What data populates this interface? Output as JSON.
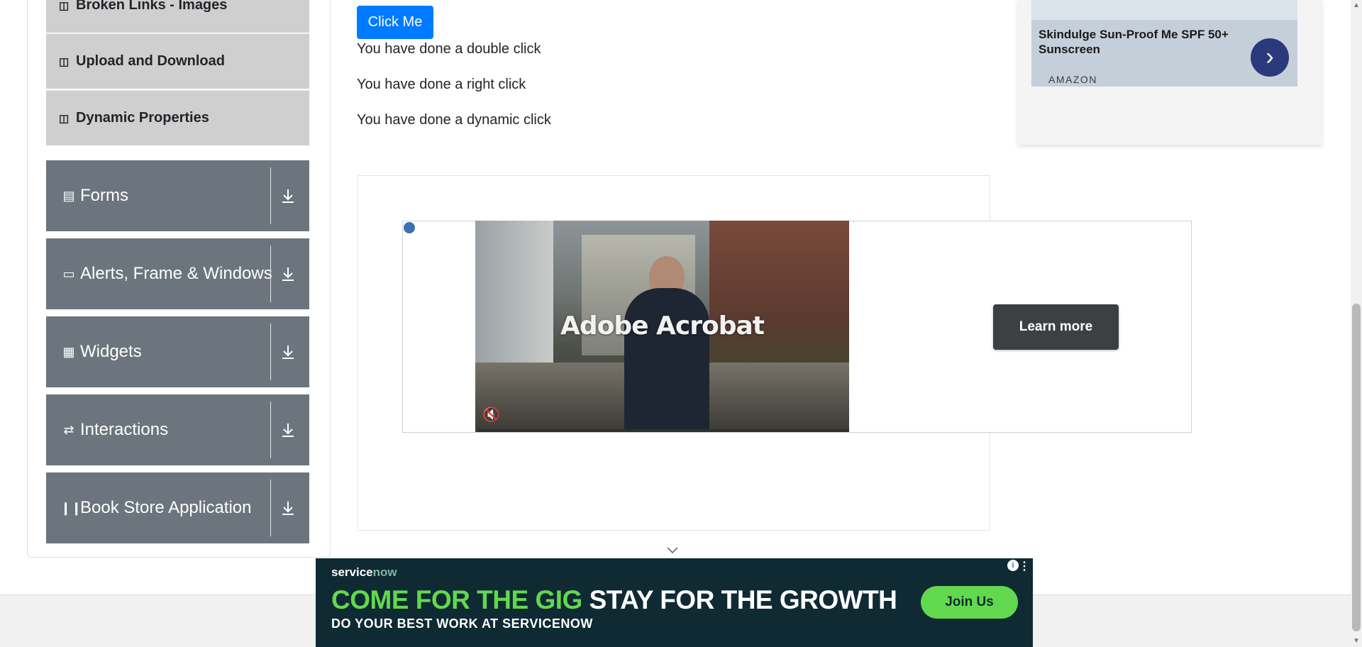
{
  "sidebar": {
    "sub_items": [
      {
        "label": "Broken Links - Images",
        "icon": "html5-icon"
      },
      {
        "label": "Upload and Download",
        "icon": "html5-icon"
      },
      {
        "label": "Dynamic Properties",
        "icon": "html5-icon"
      }
    ],
    "groups": [
      {
        "label": "Forms",
        "icon": "document-icon"
      },
      {
        "label": "Alerts, Frame & Windows",
        "icon": "window-icon"
      },
      {
        "label": "Widgets",
        "icon": "widgets-icon"
      },
      {
        "label": "Interactions",
        "icon": "interactions-icon"
      },
      {
        "label": "Book Store Application",
        "icon": "books-icon"
      }
    ]
  },
  "main": {
    "click_button": "Click Me",
    "messages": [
      "You have done a double click",
      "You have done a right click",
      "You have done a dynamic click"
    ]
  },
  "ad_video": {
    "brand_text": "Adobe Acrobat",
    "cta": "Learn more"
  },
  "top_right_ad": {
    "title": "Skindulge Sun-Proof Me SPF 50+ Sunscreen",
    "source": "AMAZON"
  },
  "bottom_banner": {
    "logo_a": "service",
    "logo_b": "now",
    "headline_green": "COME FOR THE GIG",
    "headline_white": "STAY FOR THE GROWTH",
    "subline": "DO YOUR BEST WORK AT SERVICENOW",
    "cta": "Join Us"
  },
  "colors": {
    "primary": "#007bff",
    "sidebar_group": "#6c757d",
    "sidebar_sub": "#cfcfcf",
    "banner_bg": "#0f2a33",
    "banner_green": "#62d84e"
  }
}
